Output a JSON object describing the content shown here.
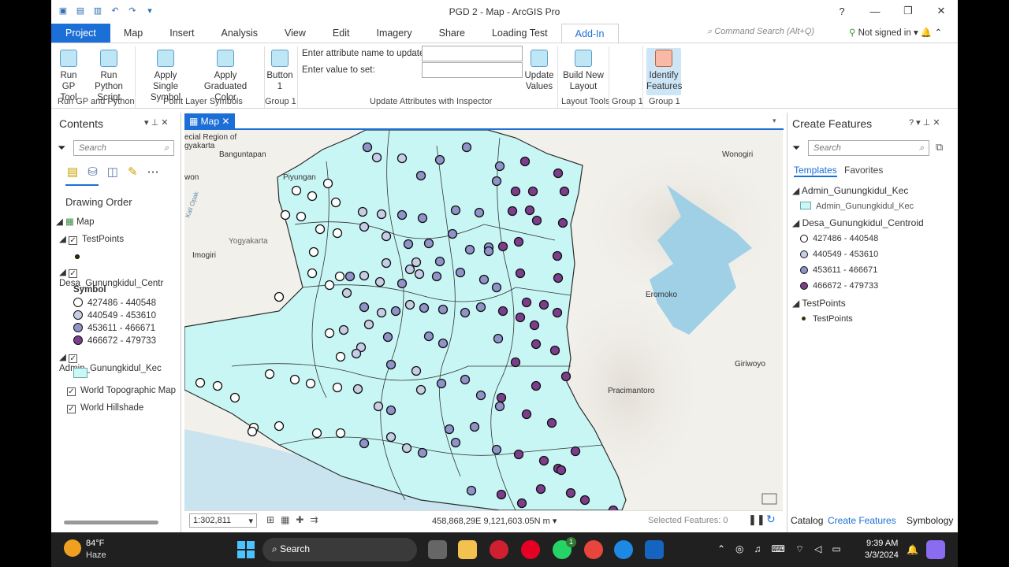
{
  "window": {
    "title": "PGD 2 - Map - ArcGIS Pro",
    "help": "?",
    "min": "—",
    "max": "❐",
    "close": "✕"
  },
  "ribbon_tabs": [
    "Project",
    "Map",
    "Insert",
    "Analysis",
    "View",
    "Edit",
    "Imagery",
    "Share",
    "Loading Test",
    "Add-In"
  ],
  "command_search": {
    "placeholder": "Command Search (Alt+Q)"
  },
  "user": {
    "label": "Not signed in"
  },
  "ribbon": {
    "run_gp": "Run GP\nTool",
    "run_py": "Run Python\nScript",
    "apply_single": "Apply Single\nSymbol",
    "apply_grad": "Apply\nGraduated Color",
    "button1": "Button\n1",
    "attr_name_label": "Enter attribute name to update:",
    "value_label": "Enter value to set:",
    "update_values": "Update\nValues",
    "build_layout": "Build New\nLayout",
    "identify": "Identify\nFeatures",
    "groups": {
      "gp": "Run GP and Python",
      "pls": "Point Layer Symbols",
      "g1a": "Group 1",
      "ua": "Update Attributes with Inspector",
      "lt": "Layout Tools",
      "g1b": "Group 1",
      "g1c": "Group 1"
    }
  },
  "contents": {
    "title": "Contents",
    "search_placeholder": "Search",
    "drawing_order": "Drawing Order",
    "map": "Map",
    "testpoints": "TestPoints",
    "desa": "Desa_Gunungkidul_Centr",
    "symbol": "Symbol",
    "classes": [
      "427486 - 440548",
      "440549 - 453610",
      "453611 - 466671",
      "466672 - 479733"
    ],
    "admin": "Admin_Gunungkidul_Kec",
    "topo": "World Topographic Map",
    "hill": "World Hillshade"
  },
  "map": {
    "tab": "Map",
    "scale": "1:302,811",
    "coords": "458,868,29E 9,121,603.05N m",
    "selected": "Selected Features: 0",
    "places": {
      "special": "ecial Region of",
      "gyakarta": "gyakarta",
      "banguntapan": "Banguntapan",
      "wonogiri": "Wonogiri",
      "piyungan": "Piyungan",
      "won": "won",
      "yogyakarta": "Yogyakarta",
      "imogiri": "Imogiri",
      "eromoko": "Eromoko",
      "giriwoyo": "Giriwoyo",
      "pracimantoro": "Pracimantoro",
      "kali": "Kali Opak"
    }
  },
  "create": {
    "title": "Create Features",
    "search_placeholder": "Search",
    "templates": "Templates",
    "favorites": "Favorites",
    "admin": "Admin_Gunungkidul_Kec",
    "admin_item": "Admin_Gunungkidul_Kec",
    "desa": "Desa_Gunungkidul_Centroid",
    "classes": [
      "427486 - 440548",
      "440549 - 453610",
      "453611 - 466671",
      "466672 - 479733"
    ],
    "testpoints": "TestPoints",
    "testpoints_item": "TestPoints"
  },
  "bottom_tabs": [
    "Catalog",
    "Create Features",
    "Symbology"
  ],
  "class_colors": [
    "#ffffff",
    "#c7cde6",
    "#8f93c9",
    "#7c3d8c"
  ],
  "taskbar": {
    "temp": "84°F",
    "weather": "Haze",
    "search": "Search",
    "time": "9:39 AM",
    "date": "3/3/2024",
    "badge": "1"
  }
}
